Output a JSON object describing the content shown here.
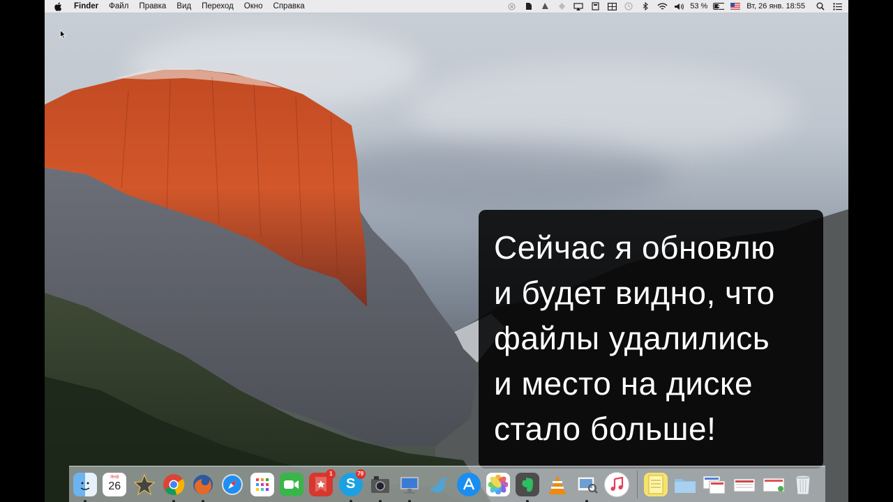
{
  "menubar": {
    "app": "Finder",
    "items": [
      "Файл",
      "Правка",
      "Вид",
      "Переход",
      "Окно",
      "Справка"
    ],
    "battery": "53 %",
    "datetime": "Вт, 26 янв.  18:55"
  },
  "caption": {
    "lines": [
      "Сейчас я обновлю",
      "и будет видно, что",
      "файлы удалились",
      "и место на диске",
      "стало больше!"
    ]
  },
  "dock": {
    "calendar_day": "26",
    "skype_badge": "79",
    "wunderlist_badge": "1",
    "apps": [
      "finder-icon",
      "calendar-icon",
      "imovie-icon",
      "chrome-icon",
      "firefox-icon",
      "safari-icon",
      "launchpad-icon",
      "facetime-icon",
      "wunderlist-icon",
      "skype-icon",
      "photo-booth-icon",
      "keynote-icon",
      "twitterrific-icon",
      "app-store-icon",
      "photos-icon",
      "evernote-icon",
      "vlc-icon",
      "preview-icon",
      "itunes-icon"
    ]
  }
}
